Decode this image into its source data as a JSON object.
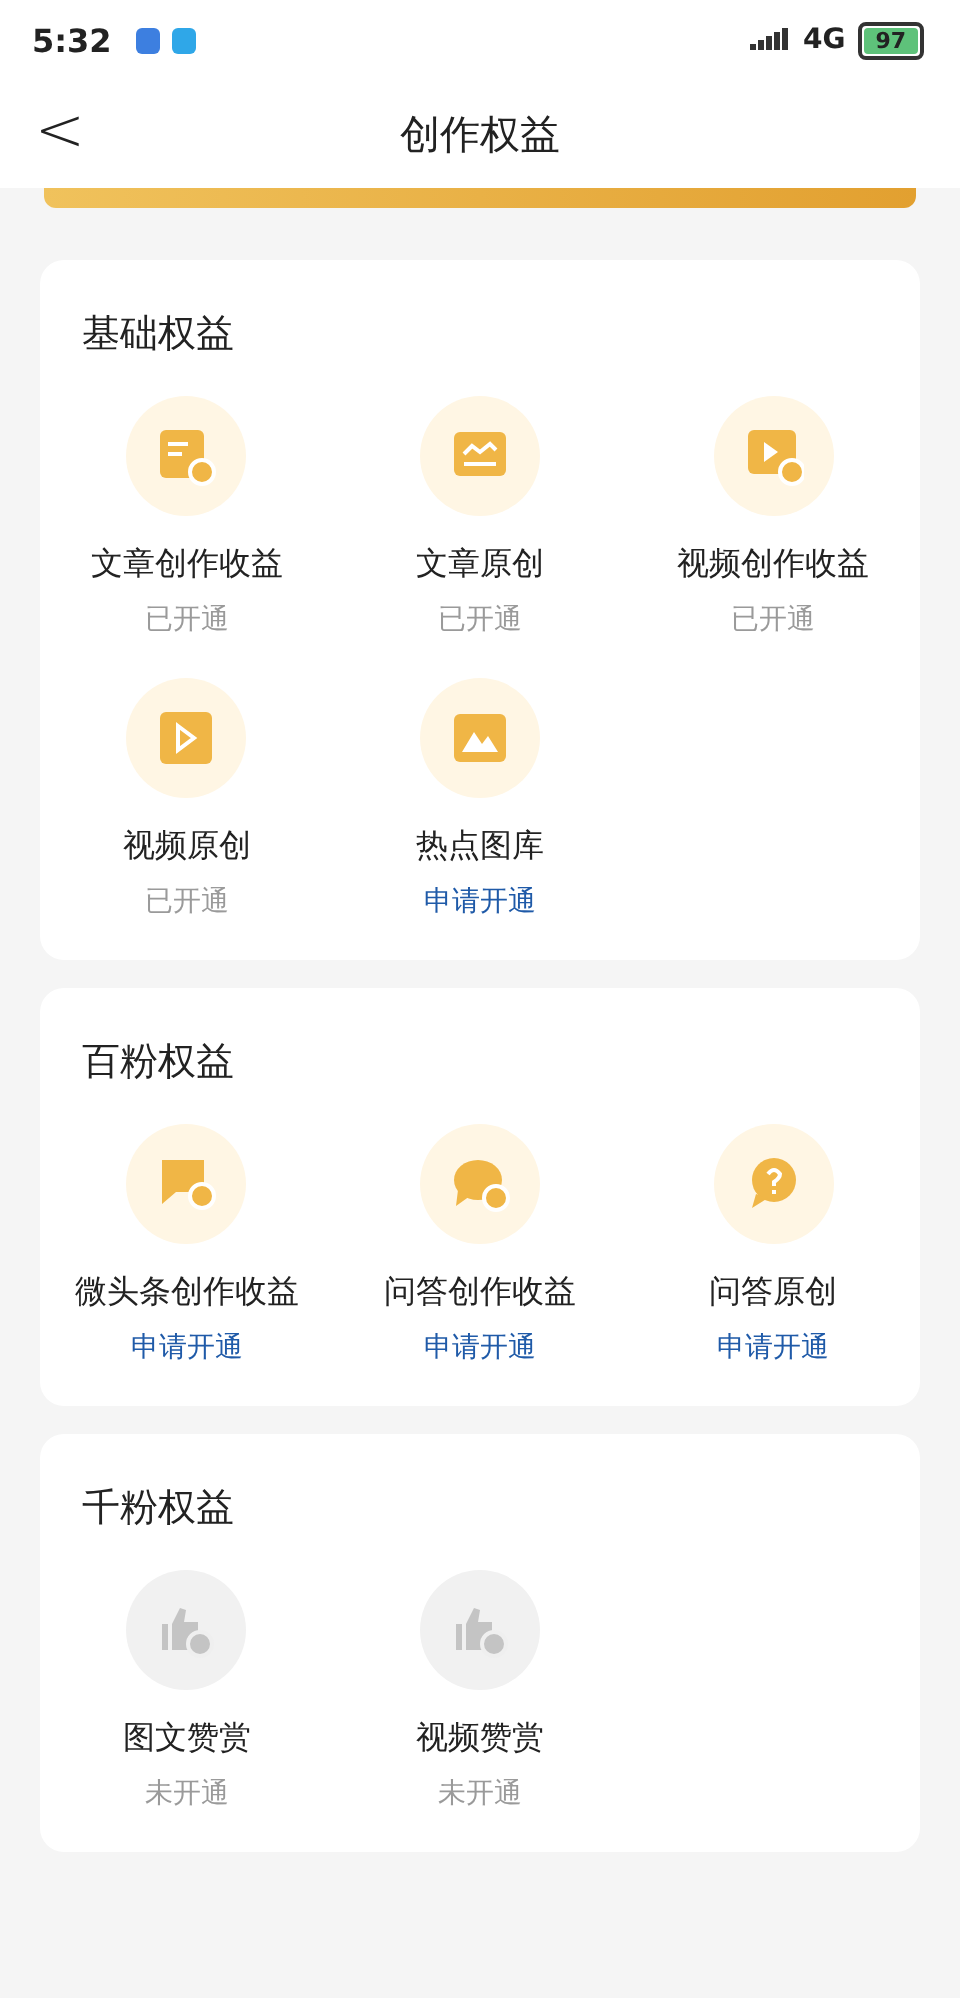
{
  "status_bar": {
    "time": "5:32",
    "network": "4G",
    "battery": "97"
  },
  "nav": {
    "back": "<",
    "title": "创作权益"
  },
  "sections": [
    {
      "title": "基础权益",
      "items": [
        {
          "label": "文章创作收益",
          "status": "已开通",
          "kind": "opened"
        },
        {
          "label": "文章原创",
          "status": "已开通",
          "kind": "opened"
        },
        {
          "label": "视频创作收益",
          "status": "已开通",
          "kind": "opened"
        },
        {
          "label": "视频原创",
          "status": "已开通",
          "kind": "opened"
        },
        {
          "label": "热点图库",
          "status": "申请开通",
          "kind": "apply"
        }
      ]
    },
    {
      "title": "百粉权益",
      "items": [
        {
          "label": "微头条创作收益",
          "status": "申请开通",
          "kind": "apply"
        },
        {
          "label": "问答创作收益",
          "status": "申请开通",
          "kind": "apply"
        },
        {
          "label": "问答原创",
          "status": "申请开通",
          "kind": "apply"
        }
      ]
    },
    {
      "title": "千粉权益",
      "items": [
        {
          "label": "图文赞赏",
          "status": "未开通",
          "kind": "closed"
        },
        {
          "label": "视频赞赏",
          "status": "未开通",
          "kind": "closed"
        }
      ]
    }
  ]
}
